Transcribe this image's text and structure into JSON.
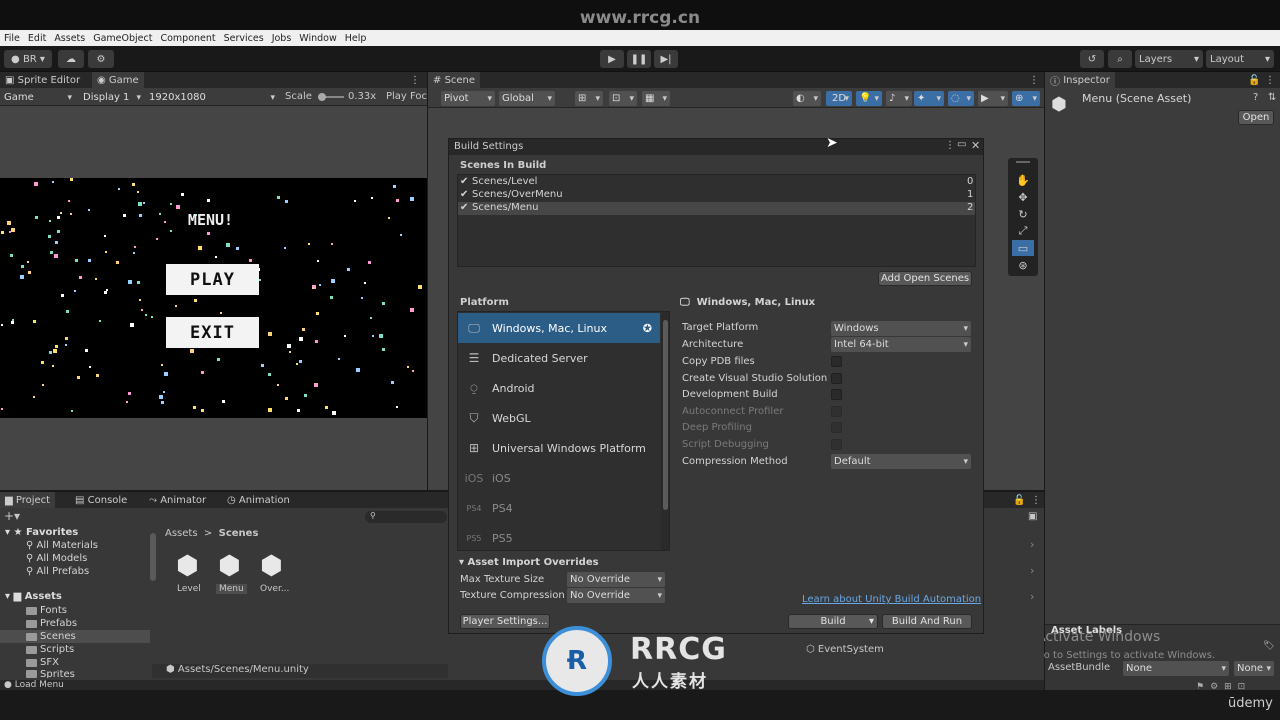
{
  "watermark": {
    "top": "www.rrcg.cn",
    "brand": "RRCG",
    "brand_cn": "人人素材",
    "udemy": "ūdemy",
    "activate_title": "Activate Windows",
    "activate_sub": "Go to Settings to activate Windows."
  },
  "menubar": [
    "File",
    "Edit",
    "Assets",
    "GameObject",
    "Component",
    "Services",
    "Jobs",
    "Window",
    "Help"
  ],
  "toolbar": {
    "account": "BR",
    "layers": "Layers",
    "layout": "Layout"
  },
  "game_panel": {
    "tab_sprite": "Sprite Editor",
    "tab_game": "Game",
    "mode": "Game",
    "display": "Display 1",
    "resolution": "1920x1080",
    "scale_label": "Scale",
    "scale_value": "0.33x",
    "play_focus": "Play Foc",
    "menu_title": "MENU!",
    "play_btn": "PLAY",
    "exit_btn": "EXIT"
  },
  "scene_panel": {
    "tab": "Scene",
    "pivot": "Pivot",
    "global": "Global",
    "mode2d": "2D"
  },
  "inspector": {
    "tab": "Inspector",
    "title": "Menu (Scene Asset)",
    "open": "Open",
    "asset_labels": "Asset Labels",
    "assetbundle_label": "AssetBundle",
    "assetbundle_value": "None",
    "variant_value": "None"
  },
  "build_settings": {
    "title": "Build Settings",
    "scenes_header": "Scenes In Build",
    "scenes": [
      {
        "name": "Scenes/Level",
        "index": "0"
      },
      {
        "name": "Scenes/OverMenu",
        "index": "1"
      },
      {
        "name": "Scenes/Menu",
        "index": "2"
      }
    ],
    "add_open_scenes": "Add Open Scenes",
    "platform_header": "Platform",
    "platforms": [
      {
        "name": "Windows, Mac, Linux",
        "icon": "monitor-icon"
      },
      {
        "name": "Dedicated Server",
        "icon": "server-icon"
      },
      {
        "name": "Android",
        "icon": "android-icon"
      },
      {
        "name": "WebGL",
        "icon": "html5-icon"
      },
      {
        "name": "Universal Windows Platform",
        "icon": "windows-icon"
      },
      {
        "name": "iOS",
        "icon": "ios-icon"
      },
      {
        "name": "PS4",
        "icon": "ps4-icon"
      },
      {
        "name": "PS5",
        "icon": "ps5-icon"
      }
    ],
    "selected_platform": "Windows, Mac, Linux",
    "settings": {
      "target_platform_label": "Target Platform",
      "target_platform_value": "Windows",
      "architecture_label": "Architecture",
      "architecture_value": "Intel 64-bit",
      "copy_pdb": "Copy PDB files",
      "create_vs": "Create Visual Studio Solution",
      "dev_build": "Development Build",
      "autoconnect": "Autoconnect Profiler",
      "deep_profiling": "Deep Profiling",
      "script_debugging": "Script Debugging",
      "compression_label": "Compression Method",
      "compression_value": "Default"
    },
    "asset_import_header": "Asset Import Overrides",
    "max_texture_label": "Max Texture Size",
    "max_texture_value": "No Override",
    "texture_compression_label": "Texture Compression",
    "texture_compression_value": "No Override",
    "learn_link": "Learn about Unity Build Automation",
    "player_settings": "Player Settings...",
    "build": "Build",
    "build_and_run": "Build And Run"
  },
  "project_panel": {
    "tab_project": "Project",
    "tab_console": "Console",
    "tab_animator": "Animator",
    "tab_animation": "Animation",
    "favorites": "Favorites",
    "fav_items": [
      "All Materials",
      "All Models",
      "All Prefabs"
    ],
    "assets": "Assets",
    "folders": [
      "Fonts",
      "Prefabs",
      "Scenes",
      "Scripts",
      "SFX",
      "Sprites"
    ],
    "breadcrumb_root": "Assets",
    "breadcrumb_leaf": "Scenes",
    "files": [
      "Level",
      "Menu",
      "Over..."
    ],
    "path": "Assets/Scenes/Menu.unity",
    "status": "Load Menu"
  },
  "hierarchy": {
    "item": "EventSystem"
  }
}
